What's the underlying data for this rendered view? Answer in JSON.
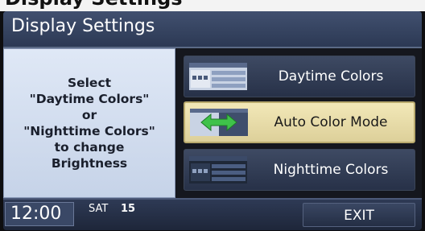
{
  "top_text": "Display Settings",
  "title": "Display Settings",
  "info": {
    "text": "Select\n\"Daytime Colors\"\nor\n\"Nighttime Colors\"\nto change\nBrightness"
  },
  "menu": [
    {
      "label": "Daytime Colors",
      "icon": "daytime-screen-icon",
      "selected": false
    },
    {
      "label": "Auto Color Mode",
      "icon": "auto-mode-arrows-icon",
      "selected": true
    },
    {
      "label": "Nighttime Colors",
      "icon": "nighttime-screen-icon",
      "selected": false
    }
  ],
  "status": {
    "clock": "12:00",
    "day": "SAT",
    "date": "15",
    "exit_label": "EXIT"
  },
  "colors": {
    "title_bar": "#2c3954",
    "info_panel": "#dfe8f6",
    "selected_button": "#ecdfae",
    "button": "#2f3a52"
  }
}
